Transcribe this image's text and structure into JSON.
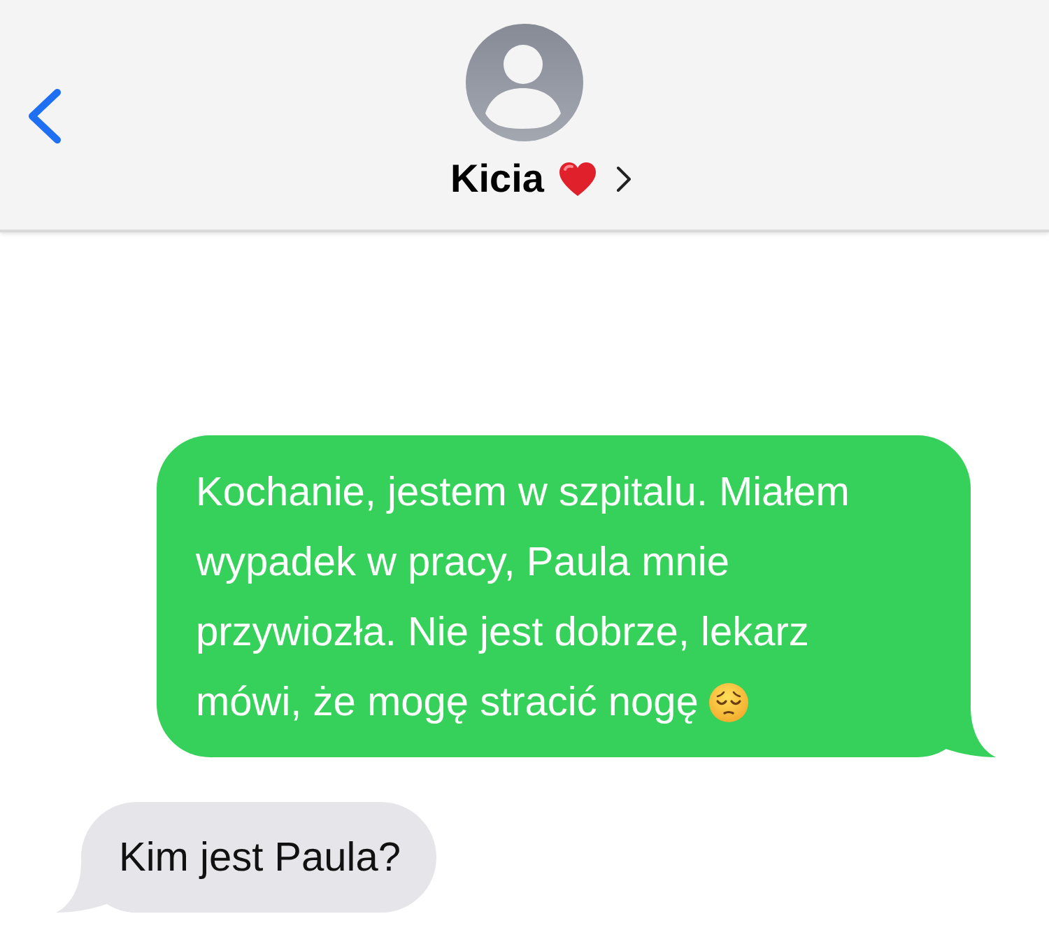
{
  "header": {
    "contact_name": "Kicia"
  },
  "messages": [
    {
      "kind": "sent",
      "text": "Kochanie, jestem w szpitalu. Miałem wypadek w pracy, Paula mnie przywiozła. Nie jest dobrze, lekarz mówi, że mogę stracić nogę",
      "emoji": true
    },
    {
      "kind": "received",
      "text": "Kim jest Paula?",
      "emoji": false
    }
  ]
}
